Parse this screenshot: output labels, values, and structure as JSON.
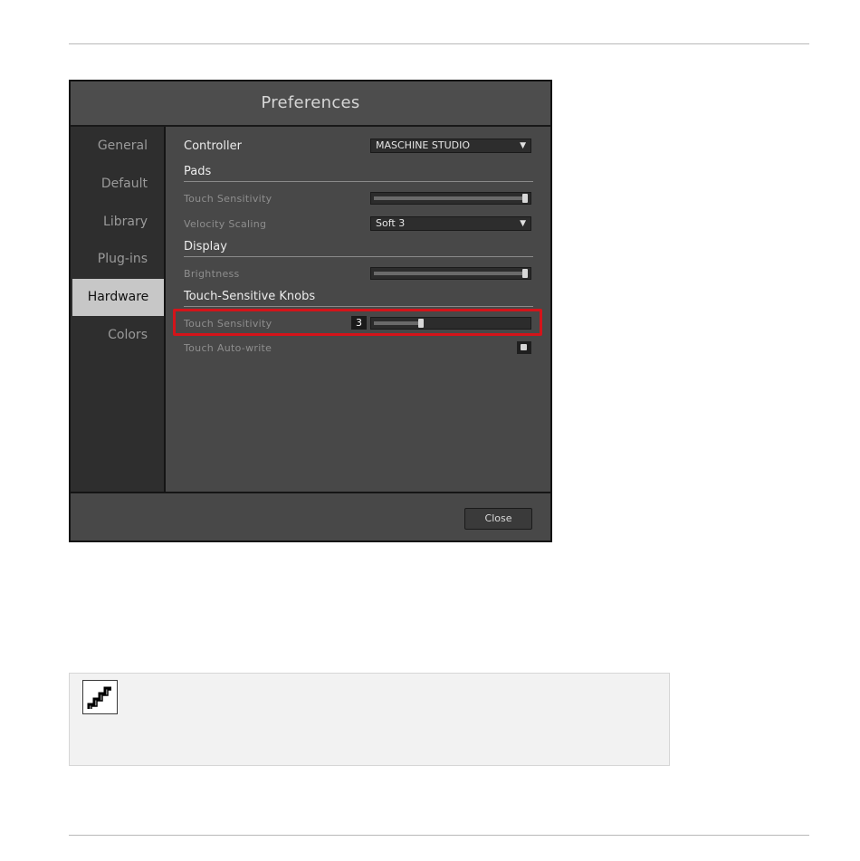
{
  "dialog": {
    "title": "Preferences",
    "sidebar": {
      "items": [
        {
          "label": "General"
        },
        {
          "label": "Default"
        },
        {
          "label": "Library"
        },
        {
          "label": "Plug-ins"
        },
        {
          "label": "Hardware",
          "active": true
        },
        {
          "label": "Colors"
        }
      ]
    },
    "hardware": {
      "controller_label": "Controller",
      "controller_value": "MASCHINE STUDIO",
      "pads_header": "Pads",
      "pads_touch_label": "Touch Sensitivity",
      "pads_touch_level": 1.0,
      "velocity_label": "Velocity Scaling",
      "velocity_value": "Soft 3",
      "display_header": "Display",
      "brightness_label": "Brightness",
      "brightness_level": 1.0,
      "knobs_header": "Touch-Sensitive Knobs",
      "knobs_touch_label": "Touch Sensitivity",
      "knobs_touch_value": "3",
      "knobs_touch_level": 0.3,
      "autowrite_label": "Touch Auto-write",
      "autowrite_checked": true
    },
    "close_label": "Close"
  },
  "colors": {
    "highlight": "#d4141a",
    "active_tab_bg": "#c7c7c7"
  },
  "icons": {
    "note_icon": "stairs-icon"
  }
}
